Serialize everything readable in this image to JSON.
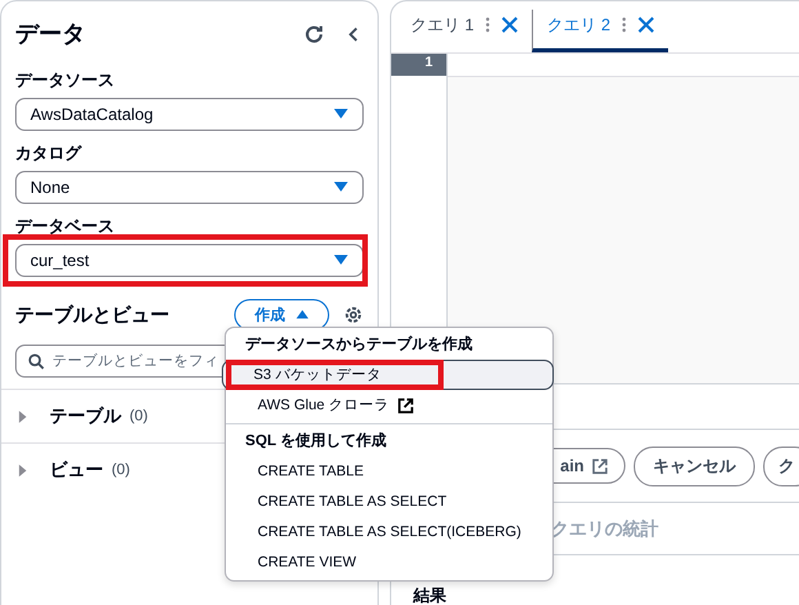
{
  "sidebar": {
    "title": "データ",
    "selects": [
      {
        "label": "データソース",
        "value": "AwsDataCatalog",
        "annotated": false
      },
      {
        "label": "カタログ",
        "value": "None",
        "annotated": false
      },
      {
        "label": "データベース",
        "value": "cur_test",
        "annotated": true
      }
    ],
    "section_title": "テーブルとビュー",
    "create_button": "作成",
    "search": {
      "placeholder": "テーブルとビューをフィ"
    },
    "tree": [
      {
        "label": "テーブル",
        "count": "(0)",
        "expanded": false
      },
      {
        "label": "ビュー",
        "count": "(0)",
        "expanded": false
      }
    ]
  },
  "tabs": [
    {
      "label": "クエリ 1",
      "selected": false
    },
    {
      "label": "クエリ 2",
      "selected": true
    }
  ],
  "editor": {
    "line_numbers": [
      "1"
    ]
  },
  "buttons": [
    {
      "label": "ain",
      "external": true
    },
    {
      "label": "キャンセル",
      "external": false
    },
    {
      "label": "ク",
      "external": false
    }
  ],
  "stats_label": "クエリの統計",
  "results_title": "結果",
  "menu": {
    "groups": [
      {
        "title": "データソースからテーブルを作成",
        "items": [
          {
            "label": "S3 バケットデータ",
            "highlighted": true,
            "annotated": true,
            "external": false
          },
          {
            "label": "AWS Glue クローラ",
            "highlighted": false,
            "annotated": false,
            "external": true
          }
        ]
      },
      {
        "title": "SQL を使用して作成",
        "items": [
          {
            "label": "CREATE TABLE",
            "highlighted": false,
            "annotated": false,
            "external": false
          },
          {
            "label": "CREATE TABLE AS SELECT",
            "highlighted": false,
            "annotated": false,
            "external": false
          },
          {
            "label": "CREATE TABLE AS SELECT(ICEBERG)",
            "highlighted": false,
            "annotated": false,
            "external": false
          },
          {
            "label": "CREATE VIEW",
            "highlighted": false,
            "annotated": false,
            "external": false
          }
        ]
      }
    ]
  }
}
